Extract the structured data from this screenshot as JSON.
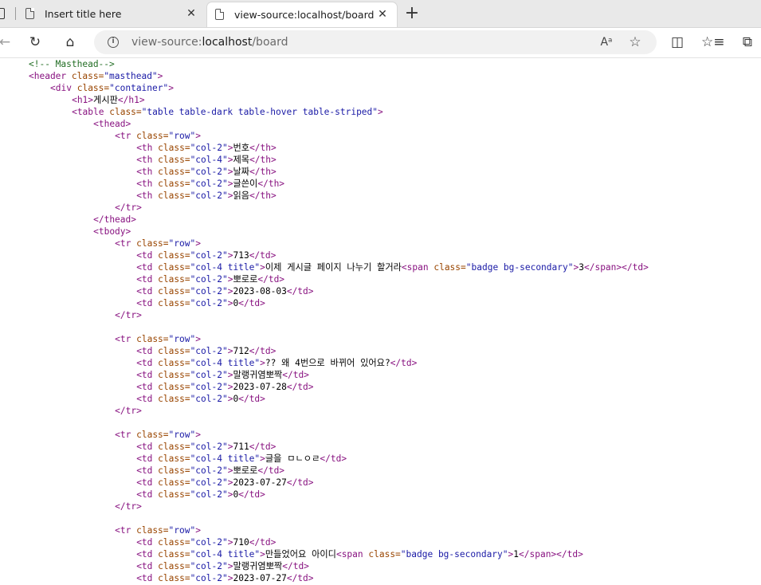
{
  "tabs": [
    {
      "title": "Insert title here",
      "close": "✕",
      "active": false
    },
    {
      "title": "view-source:localhost/board",
      "close": "✕",
      "active": true
    }
  ],
  "new_tab": "+",
  "toolbar": {
    "back": "←",
    "reload": "↻",
    "home": "⌂",
    "url_prefix": "view-source:",
    "url_host": "localhost",
    "url_path": "/board",
    "read_aloud": "Aᵃ",
    "favorite": "☆",
    "split_screen": "◫",
    "favorites_bar": "☆≡",
    "collections": "⧉"
  },
  "source_lines": [
    {
      "indent": 4,
      "parts": [
        {
          "t": "comment",
          "v": "<!-- Masthead-->"
        }
      ]
    },
    {
      "indent": 4,
      "parts": [
        {
          "t": "tag",
          "v": "<header "
        },
        {
          "t": "attr",
          "v": "class="
        },
        {
          "t": "val",
          "v": "\"masthead\""
        },
        {
          "t": "tag",
          "v": ">"
        }
      ]
    },
    {
      "indent": 8,
      "parts": [
        {
          "t": "tag",
          "v": "<div "
        },
        {
          "t": "attr",
          "v": "class="
        },
        {
          "t": "val",
          "v": "\"container\""
        },
        {
          "t": "tag",
          "v": ">"
        }
      ]
    },
    {
      "indent": 12,
      "parts": [
        {
          "t": "tag",
          "v": "<h1>"
        },
        {
          "t": "txt",
          "v": "게시판"
        },
        {
          "t": "tag",
          "v": "</h1>"
        }
      ]
    },
    {
      "indent": 12,
      "parts": [
        {
          "t": "tag",
          "v": "<table "
        },
        {
          "t": "attr",
          "v": "class="
        },
        {
          "t": "val",
          "v": "\"table table-dark table-hover table-striped\""
        },
        {
          "t": "tag",
          "v": ">"
        }
      ]
    },
    {
      "indent": 16,
      "parts": [
        {
          "t": "tag",
          "v": "<thead>"
        }
      ]
    },
    {
      "indent": 20,
      "parts": [
        {
          "t": "tag",
          "v": "<tr "
        },
        {
          "t": "attr",
          "v": "class="
        },
        {
          "t": "val",
          "v": "\"row\""
        },
        {
          "t": "tag",
          "v": ">"
        }
      ]
    },
    {
      "indent": 24,
      "parts": [
        {
          "t": "tag",
          "v": "<th "
        },
        {
          "t": "attr",
          "v": "class="
        },
        {
          "t": "val",
          "v": "\"col-2\""
        },
        {
          "t": "tag",
          "v": ">"
        },
        {
          "t": "txt",
          "v": "번호"
        },
        {
          "t": "tag",
          "v": "</th>"
        }
      ]
    },
    {
      "indent": 24,
      "parts": [
        {
          "t": "tag",
          "v": "<th "
        },
        {
          "t": "attr",
          "v": "class="
        },
        {
          "t": "val",
          "v": "\"col-4\""
        },
        {
          "t": "tag",
          "v": ">"
        },
        {
          "t": "txt",
          "v": "제목"
        },
        {
          "t": "tag",
          "v": "</th>"
        }
      ]
    },
    {
      "indent": 24,
      "parts": [
        {
          "t": "tag",
          "v": "<th "
        },
        {
          "t": "attr",
          "v": "class="
        },
        {
          "t": "val",
          "v": "\"col-2\""
        },
        {
          "t": "tag",
          "v": ">"
        },
        {
          "t": "txt",
          "v": "날짜"
        },
        {
          "t": "tag",
          "v": "</th>"
        }
      ]
    },
    {
      "indent": 24,
      "parts": [
        {
          "t": "tag",
          "v": "<th "
        },
        {
          "t": "attr",
          "v": "class="
        },
        {
          "t": "val",
          "v": "\"col-2\""
        },
        {
          "t": "tag",
          "v": ">"
        },
        {
          "t": "txt",
          "v": "글쓴이"
        },
        {
          "t": "tag",
          "v": "</th>"
        }
      ]
    },
    {
      "indent": 24,
      "parts": [
        {
          "t": "tag",
          "v": "<th "
        },
        {
          "t": "attr",
          "v": "class="
        },
        {
          "t": "val",
          "v": "\"col-2\""
        },
        {
          "t": "tag",
          "v": ">"
        },
        {
          "t": "txt",
          "v": "읽음"
        },
        {
          "t": "tag",
          "v": "</th>"
        }
      ]
    },
    {
      "indent": 20,
      "parts": [
        {
          "t": "tag",
          "v": "</tr>"
        }
      ]
    },
    {
      "indent": 16,
      "parts": [
        {
          "t": "tag",
          "v": "</thead>"
        }
      ]
    },
    {
      "indent": 16,
      "parts": [
        {
          "t": "tag",
          "v": "<tbody>"
        }
      ]
    },
    {
      "indent": 20,
      "parts": [
        {
          "t": "tag",
          "v": "<tr "
        },
        {
          "t": "attr",
          "v": "class="
        },
        {
          "t": "val",
          "v": "\"row\""
        },
        {
          "t": "tag",
          "v": ">"
        }
      ]
    },
    {
      "indent": 24,
      "parts": [
        {
          "t": "tag",
          "v": "<td "
        },
        {
          "t": "attr",
          "v": "class="
        },
        {
          "t": "val",
          "v": "\"col-2\""
        },
        {
          "t": "tag",
          "v": ">"
        },
        {
          "t": "txt",
          "v": "713"
        },
        {
          "t": "tag",
          "v": "</td>"
        }
      ]
    },
    {
      "indent": 24,
      "parts": [
        {
          "t": "tag",
          "v": "<td "
        },
        {
          "t": "attr",
          "v": "class="
        },
        {
          "t": "val",
          "v": "\"col-4 title\""
        },
        {
          "t": "tag",
          "v": ">"
        },
        {
          "t": "txt",
          "v": "이제 게시글 페이지 나누기 할거라"
        },
        {
          "t": "tag",
          "v": "<span "
        },
        {
          "t": "attr",
          "v": "class="
        },
        {
          "t": "val",
          "v": "\"badge bg-secondary\""
        },
        {
          "t": "tag",
          "v": ">"
        },
        {
          "t": "txt",
          "v": "3"
        },
        {
          "t": "tag",
          "v": "</span></td>"
        }
      ]
    },
    {
      "indent": 24,
      "parts": [
        {
          "t": "tag",
          "v": "<td "
        },
        {
          "t": "attr",
          "v": "class="
        },
        {
          "t": "val",
          "v": "\"col-2\""
        },
        {
          "t": "tag",
          "v": ">"
        },
        {
          "t": "txt",
          "v": "뽀로로"
        },
        {
          "t": "tag",
          "v": "</td>"
        }
      ]
    },
    {
      "indent": 24,
      "parts": [
        {
          "t": "tag",
          "v": "<td "
        },
        {
          "t": "attr",
          "v": "class="
        },
        {
          "t": "val",
          "v": "\"col-2\""
        },
        {
          "t": "tag",
          "v": ">"
        },
        {
          "t": "txt",
          "v": "2023-08-03"
        },
        {
          "t": "tag",
          "v": "</td>"
        }
      ]
    },
    {
      "indent": 24,
      "parts": [
        {
          "t": "tag",
          "v": "<td "
        },
        {
          "t": "attr",
          "v": "class="
        },
        {
          "t": "val",
          "v": "\"col-2\""
        },
        {
          "t": "tag",
          "v": ">"
        },
        {
          "t": "txt",
          "v": "0"
        },
        {
          "t": "tag",
          "v": "</td>"
        }
      ]
    },
    {
      "indent": 20,
      "parts": [
        {
          "t": "tag",
          "v": "</tr>"
        }
      ]
    },
    {
      "indent": 0,
      "parts": []
    },
    {
      "indent": 20,
      "parts": [
        {
          "t": "tag",
          "v": "<tr "
        },
        {
          "t": "attr",
          "v": "class="
        },
        {
          "t": "val",
          "v": "\"row\""
        },
        {
          "t": "tag",
          "v": ">"
        }
      ]
    },
    {
      "indent": 24,
      "parts": [
        {
          "t": "tag",
          "v": "<td "
        },
        {
          "t": "attr",
          "v": "class="
        },
        {
          "t": "val",
          "v": "\"col-2\""
        },
        {
          "t": "tag",
          "v": ">"
        },
        {
          "t": "txt",
          "v": "712"
        },
        {
          "t": "tag",
          "v": "</td>"
        }
      ]
    },
    {
      "indent": 24,
      "parts": [
        {
          "t": "tag",
          "v": "<td "
        },
        {
          "t": "attr",
          "v": "class="
        },
        {
          "t": "val",
          "v": "\"col-4 title\""
        },
        {
          "t": "tag",
          "v": ">"
        },
        {
          "t": "txt",
          "v": "?? 왜 4번으로 바뀌어 있어요?"
        },
        {
          "t": "tag",
          "v": "</td>"
        }
      ]
    },
    {
      "indent": 24,
      "parts": [
        {
          "t": "tag",
          "v": "<td "
        },
        {
          "t": "attr",
          "v": "class="
        },
        {
          "t": "val",
          "v": "\"col-2\""
        },
        {
          "t": "tag",
          "v": ">"
        },
        {
          "t": "txt",
          "v": "말랭귀염뽀짝"
        },
        {
          "t": "tag",
          "v": "</td>"
        }
      ]
    },
    {
      "indent": 24,
      "parts": [
        {
          "t": "tag",
          "v": "<td "
        },
        {
          "t": "attr",
          "v": "class="
        },
        {
          "t": "val",
          "v": "\"col-2\""
        },
        {
          "t": "tag",
          "v": ">"
        },
        {
          "t": "txt",
          "v": "2023-07-28"
        },
        {
          "t": "tag",
          "v": "</td>"
        }
      ]
    },
    {
      "indent": 24,
      "parts": [
        {
          "t": "tag",
          "v": "<td "
        },
        {
          "t": "attr",
          "v": "class="
        },
        {
          "t": "val",
          "v": "\"col-2\""
        },
        {
          "t": "tag",
          "v": ">"
        },
        {
          "t": "txt",
          "v": "0"
        },
        {
          "t": "tag",
          "v": "</td>"
        }
      ]
    },
    {
      "indent": 20,
      "parts": [
        {
          "t": "tag",
          "v": "</tr>"
        }
      ]
    },
    {
      "indent": 0,
      "parts": []
    },
    {
      "indent": 20,
      "parts": [
        {
          "t": "tag",
          "v": "<tr "
        },
        {
          "t": "attr",
          "v": "class="
        },
        {
          "t": "val",
          "v": "\"row\""
        },
        {
          "t": "tag",
          "v": ">"
        }
      ]
    },
    {
      "indent": 24,
      "parts": [
        {
          "t": "tag",
          "v": "<td "
        },
        {
          "t": "attr",
          "v": "class="
        },
        {
          "t": "val",
          "v": "\"col-2\""
        },
        {
          "t": "tag",
          "v": ">"
        },
        {
          "t": "txt",
          "v": "711"
        },
        {
          "t": "tag",
          "v": "</td>"
        }
      ]
    },
    {
      "indent": 24,
      "parts": [
        {
          "t": "tag",
          "v": "<td "
        },
        {
          "t": "attr",
          "v": "class="
        },
        {
          "t": "val",
          "v": "\"col-4 title\""
        },
        {
          "t": "tag",
          "v": ">"
        },
        {
          "t": "txt",
          "v": "글을 ㅁㄴㅇㄹ"
        },
        {
          "t": "tag",
          "v": "</td>"
        }
      ]
    },
    {
      "indent": 24,
      "parts": [
        {
          "t": "tag",
          "v": "<td "
        },
        {
          "t": "attr",
          "v": "class="
        },
        {
          "t": "val",
          "v": "\"col-2\""
        },
        {
          "t": "tag",
          "v": ">"
        },
        {
          "t": "txt",
          "v": "뽀로로"
        },
        {
          "t": "tag",
          "v": "</td>"
        }
      ]
    },
    {
      "indent": 24,
      "parts": [
        {
          "t": "tag",
          "v": "<td "
        },
        {
          "t": "attr",
          "v": "class="
        },
        {
          "t": "val",
          "v": "\"col-2\""
        },
        {
          "t": "tag",
          "v": ">"
        },
        {
          "t": "txt",
          "v": "2023-07-27"
        },
        {
          "t": "tag",
          "v": "</td>"
        }
      ]
    },
    {
      "indent": 24,
      "parts": [
        {
          "t": "tag",
          "v": "<td "
        },
        {
          "t": "attr",
          "v": "class="
        },
        {
          "t": "val",
          "v": "\"col-2\""
        },
        {
          "t": "tag",
          "v": ">"
        },
        {
          "t": "txt",
          "v": "0"
        },
        {
          "t": "tag",
          "v": "</td>"
        }
      ]
    },
    {
      "indent": 20,
      "parts": [
        {
          "t": "tag",
          "v": "</tr>"
        }
      ]
    },
    {
      "indent": 0,
      "parts": []
    },
    {
      "indent": 20,
      "parts": [
        {
          "t": "tag",
          "v": "<tr "
        },
        {
          "t": "attr",
          "v": "class="
        },
        {
          "t": "val",
          "v": "\"row\""
        },
        {
          "t": "tag",
          "v": ">"
        }
      ]
    },
    {
      "indent": 24,
      "parts": [
        {
          "t": "tag",
          "v": "<td "
        },
        {
          "t": "attr",
          "v": "class="
        },
        {
          "t": "val",
          "v": "\"col-2\""
        },
        {
          "t": "tag",
          "v": ">"
        },
        {
          "t": "txt",
          "v": "710"
        },
        {
          "t": "tag",
          "v": "</td>"
        }
      ]
    },
    {
      "indent": 24,
      "parts": [
        {
          "t": "tag",
          "v": "<td "
        },
        {
          "t": "attr",
          "v": "class="
        },
        {
          "t": "val",
          "v": "\"col-4 title\""
        },
        {
          "t": "tag",
          "v": ">"
        },
        {
          "t": "txt",
          "v": "만들었어요 아이디"
        },
        {
          "t": "tag",
          "v": "<span "
        },
        {
          "t": "attr",
          "v": "class="
        },
        {
          "t": "val",
          "v": "\"badge bg-secondary\""
        },
        {
          "t": "tag",
          "v": ">"
        },
        {
          "t": "txt",
          "v": "1"
        },
        {
          "t": "tag",
          "v": "</span></td>"
        }
      ]
    },
    {
      "indent": 24,
      "parts": [
        {
          "t": "tag",
          "v": "<td "
        },
        {
          "t": "attr",
          "v": "class="
        },
        {
          "t": "val",
          "v": "\"col-2\""
        },
        {
          "t": "tag",
          "v": ">"
        },
        {
          "t": "txt",
          "v": "말랭귀염뽀짝"
        },
        {
          "t": "tag",
          "v": "</td>"
        }
      ]
    },
    {
      "indent": 24,
      "parts": [
        {
          "t": "tag",
          "v": "<td "
        },
        {
          "t": "attr",
          "v": "class="
        },
        {
          "t": "val",
          "v": "\"col-2\""
        },
        {
          "t": "tag",
          "v": ">"
        },
        {
          "t": "txt",
          "v": "2023-07-27"
        },
        {
          "t": "tag",
          "v": "</td>"
        }
      ]
    }
  ]
}
